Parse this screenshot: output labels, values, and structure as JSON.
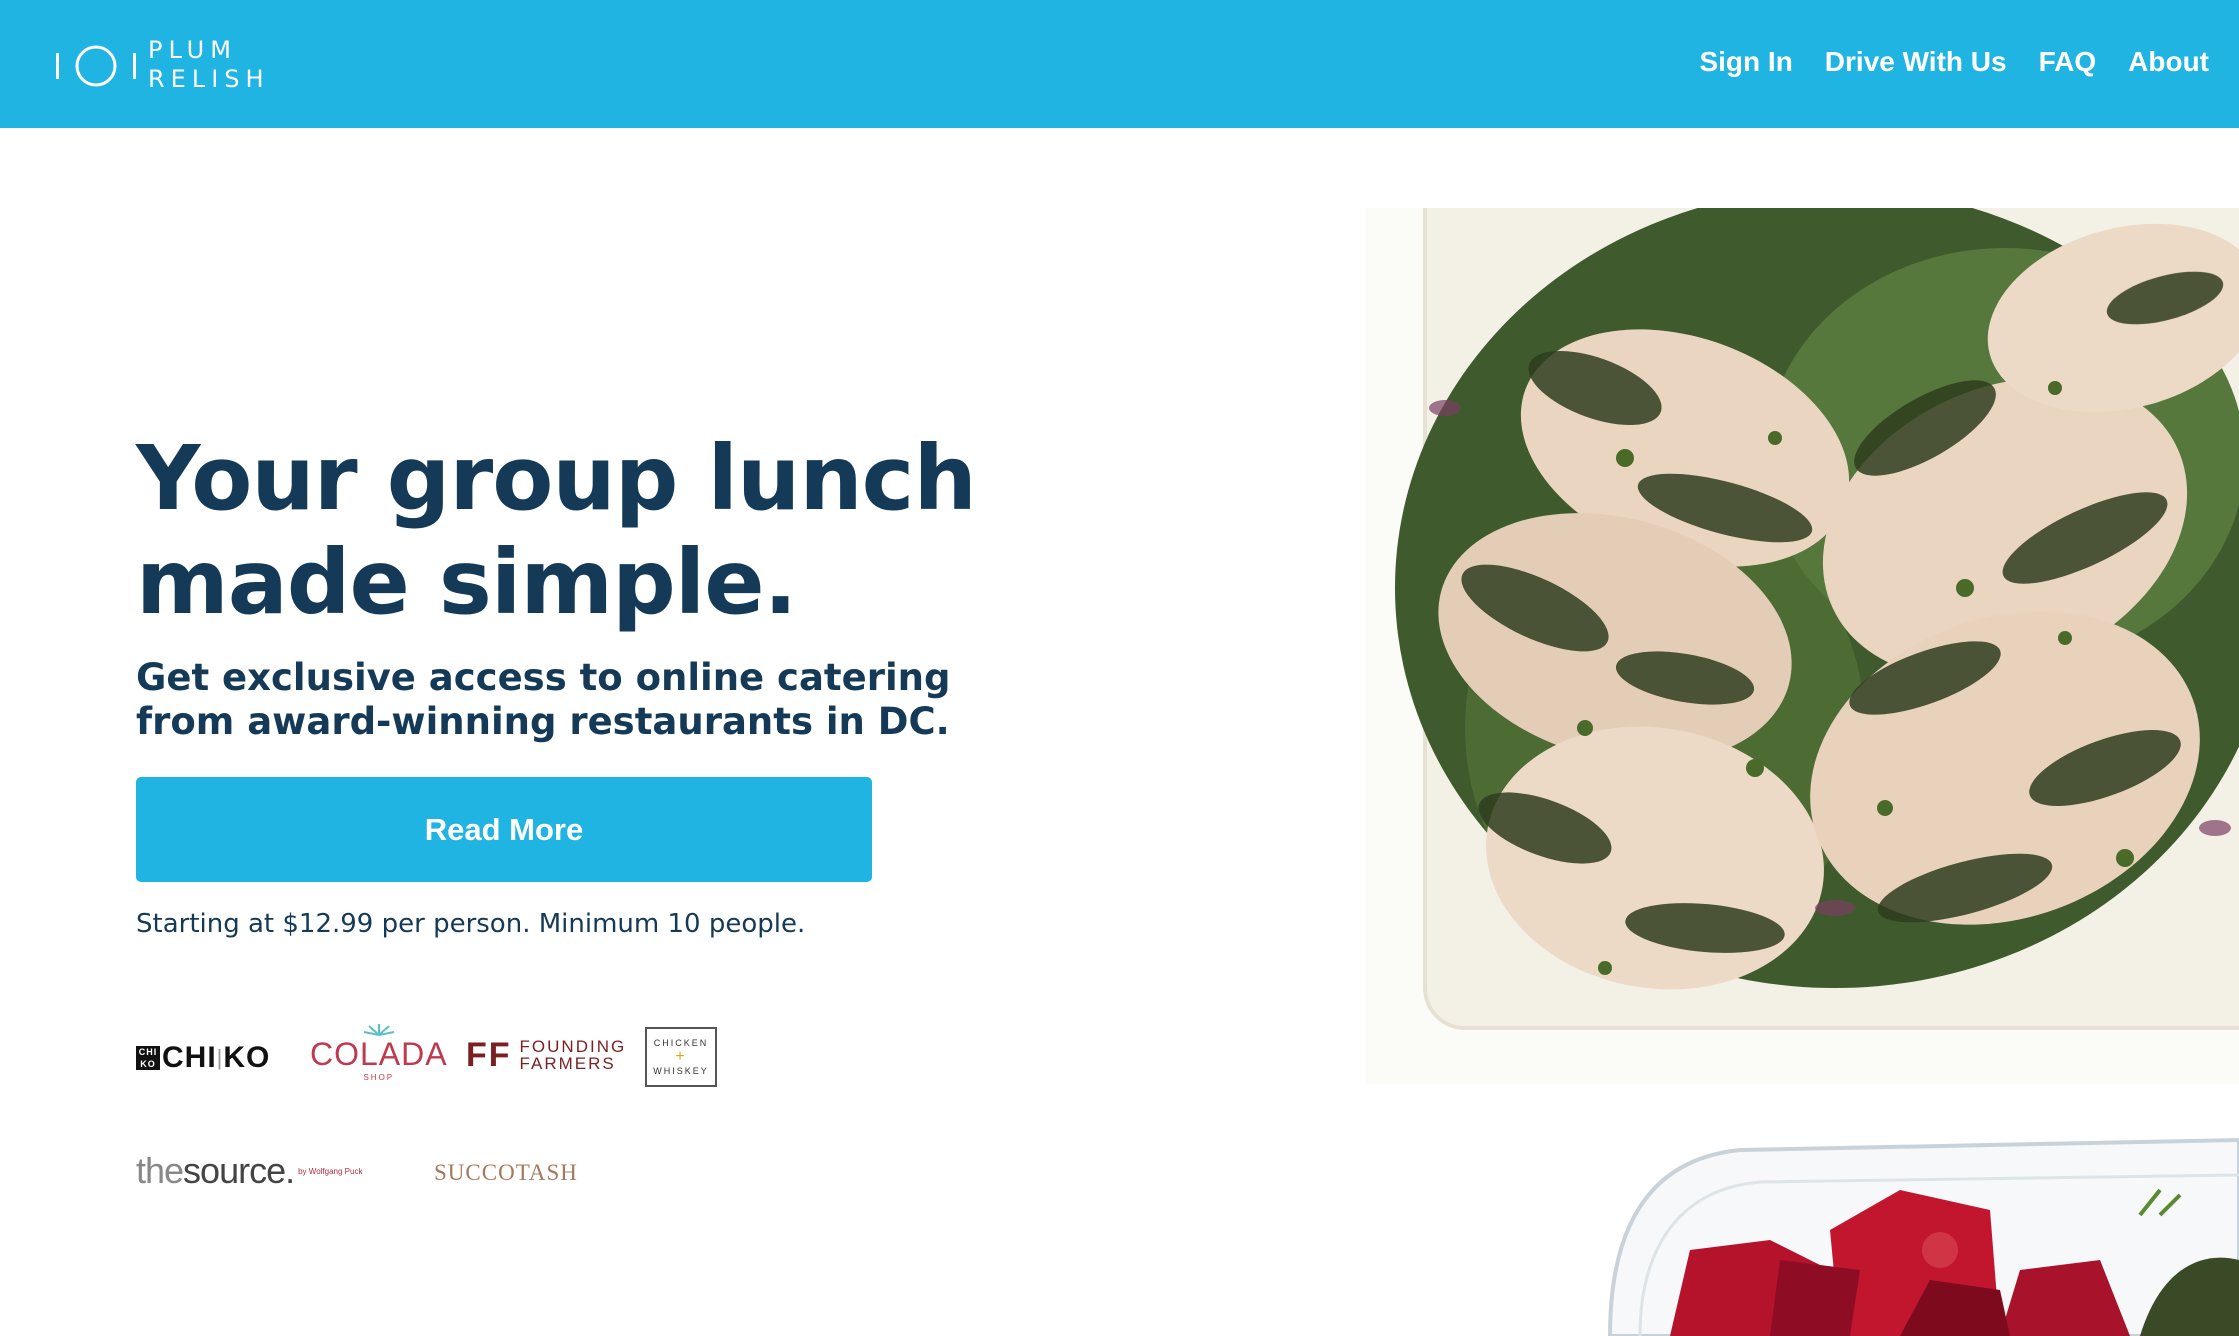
{
  "header": {
    "brand": {
      "line1": "PLUM",
      "line2": "RELISH",
      "icon": "plum-relish-logo-icon"
    },
    "nav": [
      {
        "label": "Sign In"
      },
      {
        "label": "Drive With Us"
      },
      {
        "label": "FAQ"
      },
      {
        "label": "About"
      }
    ],
    "background_color": "#1fb4e1"
  },
  "hero": {
    "title_line1": "Your group lunch",
    "title_line2": "made simple.",
    "subtitle_line1": "Get exclusive access to online catering",
    "subtitle_line2": "from award-winning restaurants in DC.",
    "cta_label": "Read More",
    "pricing_note": "Starting at $12.99 per person. Minimum 10 people.",
    "text_color": "#143a57",
    "accent_color": "#1fb4e1"
  },
  "partners": {
    "chiko": {
      "box_top": "CHI",
      "box_bottom": "KO",
      "word": "CHI",
      "word_sep": "|",
      "word_end": "KO"
    },
    "colada": {
      "word": "COLADA",
      "sub": "SHOP"
    },
    "founding_farmers": {
      "mark": "FF",
      "line1": "FOUNDING",
      "line2": "FARMERS"
    },
    "chicken_whiskey": {
      "line1": "CHICKEN",
      "mid": "+",
      "line2": "WHISKEY"
    },
    "the_source": {
      "prefix": "the",
      "word": "source.",
      "by": "by Wolfgang Puck"
    },
    "succotash": {
      "word": "SUCCOTASH"
    }
  },
  "images": {
    "main": "grilled-herb-chicken-salad-photo",
    "secondary": "roasted-beets-container-photo"
  }
}
